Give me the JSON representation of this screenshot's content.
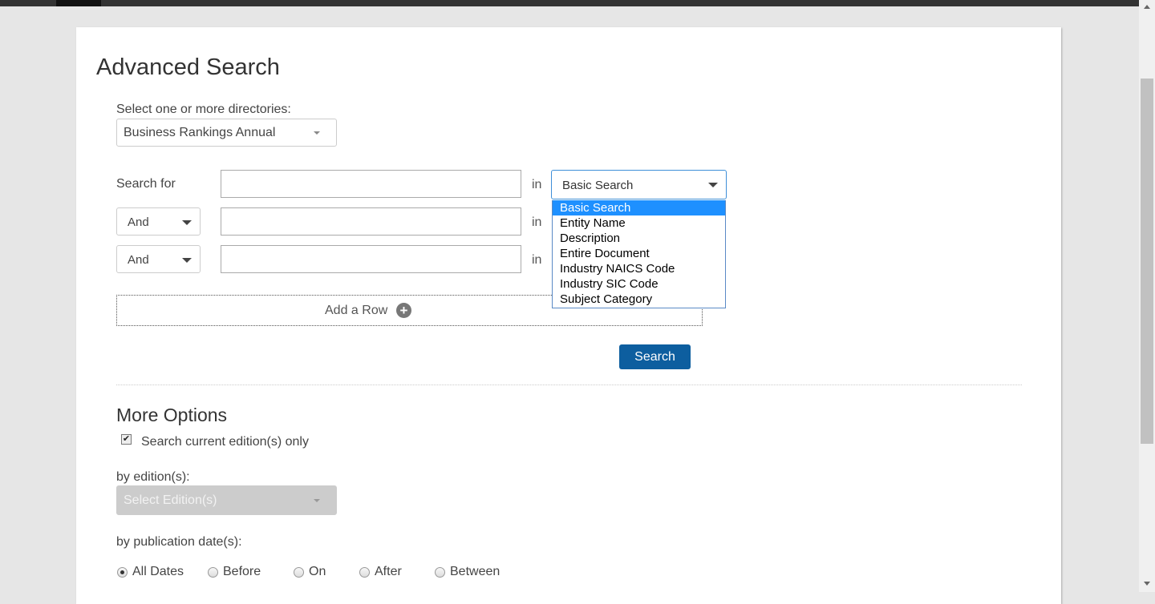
{
  "page_title": "Advanced Search",
  "directories": {
    "label": "Select one or more directories:",
    "selected": "Business Rankings Annual"
  },
  "search_rows": {
    "first_label": "Search for",
    "in_label": "in",
    "operators": [
      "And",
      "And"
    ],
    "field_selected": "Basic Search",
    "field_options": [
      "Basic Search",
      "Entity Name",
      "Description",
      "Entire Document",
      "Industry NAICS Code",
      "Industry SIC Code",
      "Subject Category"
    ]
  },
  "add_row_label": "Add a Row",
  "search_button": "Search",
  "more_options": {
    "title": "More Options",
    "current_edition_label": "Search current edition(s) only",
    "current_edition_checked": true,
    "edition_label": "by edition(s):",
    "edition_placeholder": "Select Edition(s)",
    "pubdate_label": "by publication date(s):",
    "date_options": [
      "All Dates",
      "Before",
      "On",
      "After",
      "Between"
    ],
    "date_selected": "All Dates"
  }
}
